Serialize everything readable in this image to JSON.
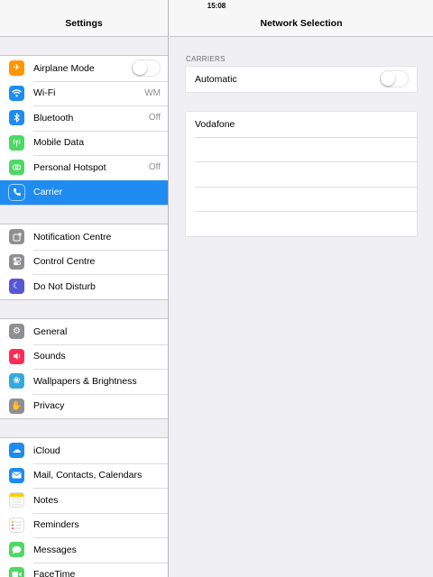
{
  "status": {
    "time": "15:08"
  },
  "left": {
    "title": "Settings",
    "groups": [
      {
        "items": [
          {
            "label": "Airplane Mode",
            "icon": "airplane-icon",
            "color": "#ff9500",
            "toggle": false
          },
          {
            "label": "Wi-Fi",
            "icon": "wifi-icon",
            "color": "#1e8cf0",
            "value": "WM"
          },
          {
            "label": "Bluetooth",
            "icon": "bluetooth-icon",
            "color": "#1e8cf0",
            "value": "Off"
          },
          {
            "label": "Mobile Data",
            "icon": "mobile-data-icon",
            "color": "#4cd964"
          },
          {
            "label": "Personal Hotspot",
            "icon": "hotspot-icon",
            "color": "#4cd964",
            "value": "Off"
          },
          {
            "label": "Carrier",
            "icon": "phone-icon",
            "color": "#4cd964",
            "selected": true
          }
        ]
      },
      {
        "items": [
          {
            "label": "Notification Centre",
            "icon": "notification-centre-icon",
            "color": "#8e8e93"
          },
          {
            "label": "Control Centre",
            "icon": "control-centre-icon",
            "color": "#8e8e93"
          },
          {
            "label": "Do Not Disturb",
            "icon": "moon-icon",
            "color": "#5856d6"
          }
        ]
      },
      {
        "items": [
          {
            "label": "General",
            "icon": "gear-icon",
            "color": "#8e8e93"
          },
          {
            "label": "Sounds",
            "icon": "speaker-icon",
            "color": "#ff2d55"
          },
          {
            "label": "Wallpapers & Brightness",
            "icon": "flower-icon",
            "color": "#34aadc"
          },
          {
            "label": "Privacy",
            "icon": "hand-icon",
            "color": "#8e8e93"
          }
        ]
      },
      {
        "items": [
          {
            "label": "iCloud",
            "icon": "cloud-icon",
            "color": "#1e8cf0"
          },
          {
            "label": "Mail, Contacts, Calendars",
            "icon": "mail-icon",
            "color": "#1e8cf0"
          },
          {
            "label": "Notes",
            "icon": "notes-icon",
            "color": "#ffcc00"
          },
          {
            "label": "Reminders",
            "icon": "reminders-icon",
            "color": "#ffffff"
          },
          {
            "label": "Messages",
            "icon": "messages-icon",
            "color": "#4cd964"
          },
          {
            "label": "FaceTime",
            "icon": "facetime-icon",
            "color": "#4cd964"
          }
        ]
      }
    ]
  },
  "right": {
    "title": "Network Selection",
    "section_label": "CARRIERS",
    "automatic": {
      "label": "Automatic",
      "toggle": false
    },
    "carriers": [
      "Vodafone",
      "",
      "",
      "",
      ""
    ]
  }
}
